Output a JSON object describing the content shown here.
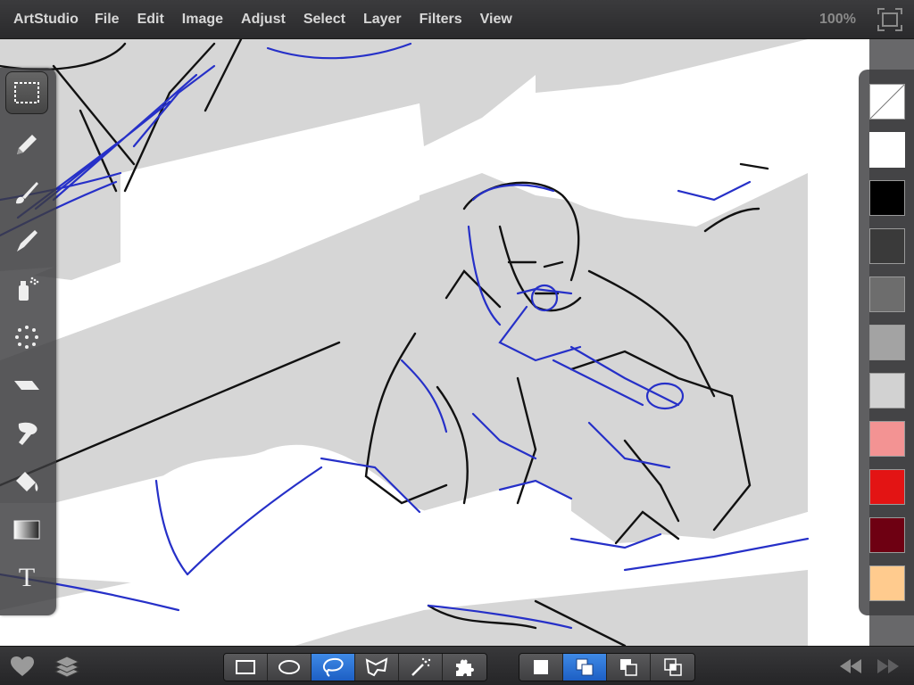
{
  "app": {
    "name": "ArtStudio"
  },
  "menu": {
    "items": [
      "File",
      "Edit",
      "Image",
      "Adjust",
      "Select",
      "Layer",
      "Filters",
      "View"
    ]
  },
  "zoom": {
    "level": "100%"
  },
  "tools": [
    {
      "name": "rectangle-select",
      "icon": "dashed-rectangle-icon",
      "selected": true
    },
    {
      "name": "pencil",
      "icon": "pencil-icon",
      "selected": false
    },
    {
      "name": "brush",
      "icon": "brush-icon",
      "selected": false
    },
    {
      "name": "smudge",
      "icon": "smudge-icon",
      "selected": false
    },
    {
      "name": "spray",
      "icon": "spray-can-icon",
      "selected": false
    },
    {
      "name": "scatter",
      "icon": "scatter-dots-icon",
      "selected": false
    },
    {
      "name": "eraser",
      "icon": "eraser-icon",
      "selected": false
    },
    {
      "name": "finger",
      "icon": "finger-icon",
      "selected": false
    },
    {
      "name": "fill",
      "icon": "paint-bucket-icon",
      "selected": false
    },
    {
      "name": "gradient",
      "icon": "gradient-icon",
      "selected": false
    },
    {
      "name": "text",
      "icon": "text-icon",
      "selected": false
    }
  ],
  "text_tool_glyph": "T",
  "colors": {
    "swatches": [
      "transparent",
      "#ffffff",
      "#000000",
      "#3a3a3a",
      "#6d6d6d",
      "#a3a3a3",
      "#d2d2d2",
      "#f39393",
      "#e31414",
      "#6e0012",
      "#ffcb8e"
    ],
    "selected_index": 1,
    "accent": "#2a62d6",
    "sketch_blue": "#2630c8"
  },
  "bottom": {
    "left_icons": [
      "heart-icon",
      "layers-icon"
    ],
    "selection_tools": [
      "rectangle-select-icon",
      "ellipse-select-icon",
      "lasso-select-icon",
      "polygon-select-icon",
      "magic-wand-icon",
      "puzzle-icon"
    ],
    "selection_tool_active": 2,
    "selection_modes": [
      "new-selection-icon",
      "add-selection-icon",
      "subtract-selection-icon",
      "intersect-selection-icon"
    ],
    "selection_mode_active": 1,
    "right_icons": [
      "rewind-icon",
      "fast-forward-icon"
    ]
  }
}
